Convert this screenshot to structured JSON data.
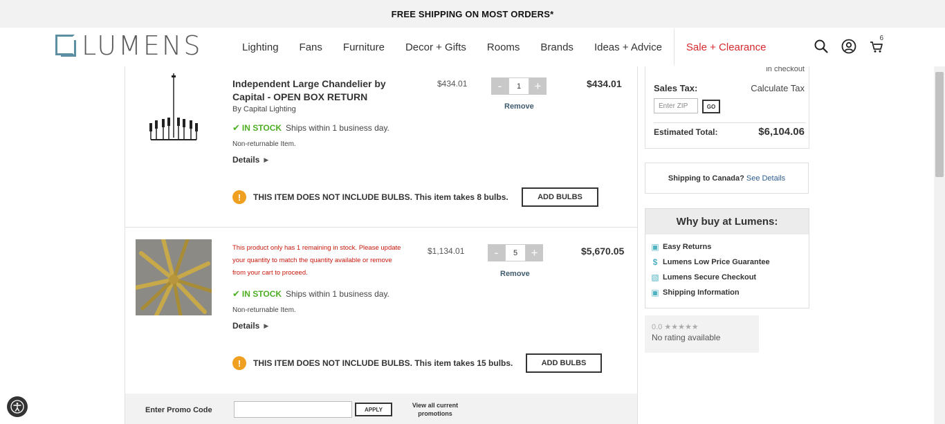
{
  "promo_bar": {
    "text": "FREE SHIPPING ON MOST ORDERS*"
  },
  "logo": {
    "text": "LUMENS"
  },
  "nav": {
    "items": [
      "Lighting",
      "Fans",
      "Furniture",
      "Decor + Gifts",
      "Rooms",
      "Brands",
      "Ideas + Advice"
    ],
    "sale": "Sale + Clearance"
  },
  "header_icons": {
    "cart_count": "6"
  },
  "cart": {
    "items": [
      {
        "title": "Independent Large Chandelier by Capital - OPEN BOX RETURN",
        "brand": "By Capital Lighting",
        "stock_label": "IN STOCK",
        "ship_text": "Ships within 1 business day.",
        "nonreturnable": "Non-returnable Item.",
        "details": "Details",
        "unit_price": "$434.01",
        "qty_minus": "-",
        "qty_plus": "+",
        "quantity": "1",
        "remove": "Remove",
        "line_total": "$434.01",
        "bulb_text": "THIS ITEM DOES NOT INCLUDE BULBS. This item takes 8 bulbs.",
        "add_bulbs": "ADD BULBS"
      },
      {
        "stock_warning": "This product only has 1 remaining in stock. Please update your quantity to match the quantity available or remove from your cart to proceed.",
        "stock_label": "IN STOCK",
        "ship_text": "Ships within 1 business day.",
        "nonreturnable": "Non-returnable Item.",
        "details": "Details",
        "unit_price": "$1,134.01",
        "qty_minus": "-",
        "qty_plus": "+",
        "quantity": "5",
        "remove": "Remove",
        "line_total": "$5,670.05",
        "bulb_text": "THIS ITEM DOES NOT INCLUDE BULBS. This item takes 15 bulbs.",
        "add_bulbs": "ADD BULBS"
      }
    ],
    "promo": {
      "label": "Enter Promo Code",
      "apply": "APPLY",
      "view_all": "View all current promotions"
    }
  },
  "summary": {
    "in_checkout": "in checkout",
    "sales_tax_label": "Sales Tax:",
    "calculate_tax": "Calculate Tax",
    "zip_placeholder": "Enter ZIP",
    "go": "GO",
    "estimated_total_label": "Estimated Total:",
    "estimated_total": "$6,104.06"
  },
  "canada": {
    "question": "Shipping to Canada?",
    "link": "See Details"
  },
  "why_buy": {
    "title": "Why buy at Lumens:",
    "items": [
      {
        "label": "Easy Returns",
        "icon": "box-icon"
      },
      {
        "label": "Lumens Low Price Guarantee",
        "icon": "dollar-icon"
      },
      {
        "label": "Lumens Secure Checkout",
        "icon": "lock-icon"
      },
      {
        "label": "Shipping Information",
        "icon": "box-icon"
      }
    ]
  },
  "rating": {
    "score": "0.0",
    "stars": "★★★★★",
    "text": "No rating available"
  }
}
